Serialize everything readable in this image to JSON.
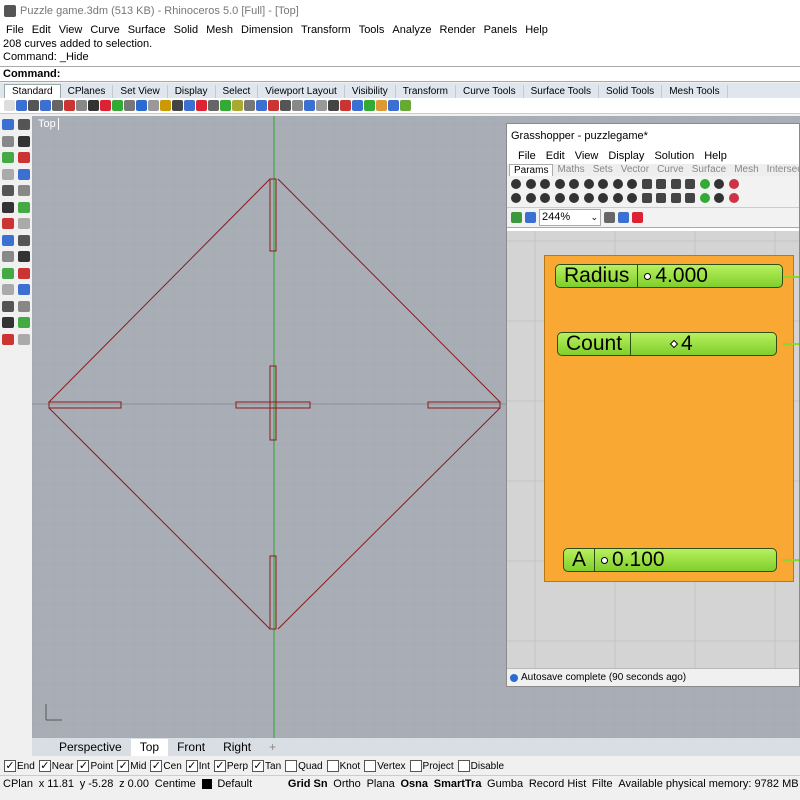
{
  "window": {
    "title": "Puzzle game.3dm (513 KB) - Rhinoceros 5.0 [Full] - [Top]"
  },
  "menu": [
    "File",
    "Edit",
    "View",
    "Curve",
    "Surface",
    "Solid",
    "Mesh",
    "Dimension",
    "Transform",
    "Tools",
    "Analyze",
    "Render",
    "Panels",
    "Help"
  ],
  "command": {
    "history": [
      "208 curves added to selection.",
      "Command: _Hide"
    ],
    "prompt": "Command:"
  },
  "toolbar_tabs": [
    "Standard",
    "CPlanes",
    "Set View",
    "Display",
    "Select",
    "Viewport Layout",
    "Visibility",
    "Transform",
    "Curve Tools",
    "Surface Tools",
    "Solid Tools",
    "Mesh Tools"
  ],
  "active_toolbar_tab": "Standard",
  "viewport": {
    "label": "Top"
  },
  "grasshopper": {
    "title": "Grasshopper - puzzlegame*",
    "menu": [
      "File",
      "Edit",
      "View",
      "Display",
      "Solution",
      "Help"
    ],
    "tabs": [
      "Params",
      "Maths",
      "Sets",
      "Vector",
      "Curve",
      "Surface",
      "Mesh",
      "Intersect"
    ],
    "zoom": "244%",
    "sliders": [
      {
        "name": "Radius",
        "value": "4.000"
      },
      {
        "name": "Count",
        "value": "4"
      },
      {
        "name": "A",
        "value": "0.100"
      }
    ],
    "status": "Autosave complete (90 seconds ago)"
  },
  "view_tabs": [
    "Perspective",
    "Top",
    "Front",
    "Right"
  ],
  "active_view_tab": "Top",
  "osnaps": [
    {
      "label": "End",
      "checked": true
    },
    {
      "label": "Near",
      "checked": true
    },
    {
      "label": "Point",
      "checked": true
    },
    {
      "label": "Mid",
      "checked": true
    },
    {
      "label": "Cen",
      "checked": true
    },
    {
      "label": "Int",
      "checked": true
    },
    {
      "label": "Perp",
      "checked": true
    },
    {
      "label": "Tan",
      "checked": true
    },
    {
      "label": "Quad",
      "checked": false
    },
    {
      "label": "Knot",
      "checked": false
    },
    {
      "label": "Vertex",
      "checked": false
    },
    {
      "label": "Project",
      "checked": false
    },
    {
      "label": "Disable",
      "checked": false
    }
  ],
  "status": {
    "cplane": "CPlan",
    "x": "x 11.81",
    "y": "y -5.28",
    "z": "z 0.00",
    "units": "Centime",
    "layer": "Default",
    "gridsnap": "Grid Sn",
    "ortho": "Ortho",
    "planar": "Plana",
    "osnap": "Osna",
    "smarttrack": "SmartTra",
    "gumball": "Gumba",
    "record": "Record Hist",
    "filter": "Filte",
    "memory": "Available physical memory: 9782 MB"
  },
  "colors": {
    "group": "#f9a933",
    "slider": "#8fdc35",
    "curve": "#8a1c1c",
    "viewport": "#a9aeb6"
  }
}
